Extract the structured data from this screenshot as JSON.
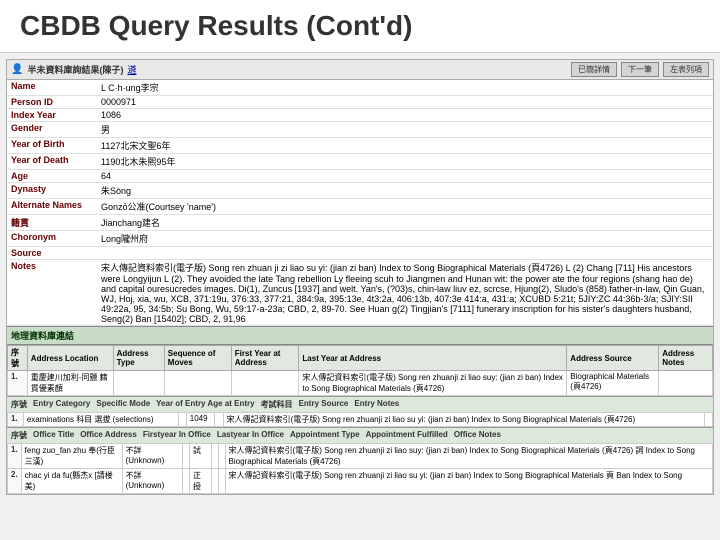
{
  "header": {
    "title": "CBDB Query Results (Cont'd)"
  },
  "topbar": {
    "person_label": "半未資料庫詢結果(陳子)",
    "link_text": "遴",
    "nav_buttons": [
      "已簡詳情",
      "下一筆",
      "左表列項"
    ]
  },
  "person": {
    "fields": [
      {
        "label": "Name",
        "value": "L C·h·ung李宗"
      },
      {
        "label": "Person ID",
        "value": "0000971"
      },
      {
        "label": "Index Year",
        "value": "1086"
      },
      {
        "label": "Gender",
        "value": "男"
      },
      {
        "label": "Year of Birth",
        "value": "1127北宋文聖6年"
      },
      {
        "label": "Year of Death",
        "value": "1190北木朱熙95年"
      },
      {
        "label": "Age",
        "value": "64"
      },
      {
        "label": "Dynasty",
        "value": "朱Sòng"
      },
      {
        "label": "Alternate Names",
        "value": "Gonzō公准(Courtsey 'name')"
      },
      {
        "label": "籍貫",
        "value": "Jianchang建名"
      },
      {
        "label": "Choronym",
        "value": "Long隴州府"
      },
      {
        "label": "Source",
        "value": ""
      },
      {
        "label": "Notes",
        "value": "宋人傳記資料索引(電子版) Song ren zhuan ji zi liao su yi: (jian zi ban) Index to Song Biographical Materials (頁4726)\nL (2) Chang [711] His ancestors were Longyijun L (2). They avoided the late Tang rebellion Ly fleeing scuh to Jiangmen and Hunan wit: the power ate the four regions (shang hao de) and capital ouresucredes images. Di(1), Zuncus [1937] and welt. Yan's, (?03)s, chin-law liuv ez, scrcse, Hjung(2), Sludo's (858) father-in-law, Qin Guan, WJ, Hoj, xia, wu, XCB, 371:19u, 376:33, 377:21, 384:9a, 395:13e, 4t3:2a, 406:13b, 407:3e 414:a, 431:a; XCUBD 5:21t; 5JIY:ZC 44:36b-3/a; SJIY:SII 49:22a, 95, 34:5b; Su Bong, Wu, 59:17-a-23a; CBD, 2, 89-70. See Huan g(2) Tingjian's [7111] funerary inscription for his sister's daughters husband, Seng(2) Ban [15402]; CBD, 2, 91,96"
      }
    ]
  },
  "section1": {
    "title": "地理資料庫連結",
    "columns": [
      "序號",
      "Address Location",
      "Address Type",
      "Sequence of Moves",
      "First Year at Address",
      "Last Year at Address",
      "Address Source",
      "Address Notes"
    ],
    "rows": [
      {
        "seq": "1.",
        "location": "重慶建川加利-同鹽 籍貫優素顏",
        "type": "",
        "sequence": "",
        "first_year": "",
        "last_year": "宋人傳記資料索引(電子版) Song ren zhuanji zi liao suy: (jian zi ban) Index to Song Biographical Materials (頁4726)",
        "source": "Biographical Materials (頁4726)",
        "notes": ""
      }
    ]
  },
  "section2": {
    "title": "",
    "sub_cols1": [
      "序號",
      "Entry Category",
      "Specific Mode",
      "Year of Entry Age at Entry",
      "考試科目",
      "Entry Source",
      "Entry Notes"
    ],
    "sub_rows1": [
      {
        "seq": "1.",
        "category": "examinations 科目 選拔 (selections)",
        "mode": "",
        "year": "1049",
        "age": "",
        "source": "宋人傳記資料索引(電子版) Song ren zhuanji zi liao su yi: (jian zi ban) Index to Song Biographical Materials (頁4726)",
        "notes": ""
      }
    ]
  },
  "section3": {
    "sub_cols": [
      "序號",
      "Office Title",
      "Office Address",
      "Firstyear In Office",
      "Lastyear In Office",
      "Appointment Type",
      "Appointment Fulfilled",
      "Office Notes"
    ],
    "sub_rows": [
      {
        "seq": "1.",
        "title": "feng zuo_fan zhu 奉(行臣三漢)",
        "address": "不詳 (Unknown)",
        "first": "",
        "last": "試",
        "appt_type": "",
        "fulfilled": "",
        "notes": "宋人傳記資料索引(電子版) Song ren zhuanji zi liao suy: (jian zi ban) Index to Song Biographical Materials (頁4726) 詞 Index to Song Biographical Materials (頁4726)"
      },
      {
        "seq": "2.",
        "title": "chac yi da fu(縣杰x [請楼 美)",
        "address": "不詳 (Unknown)",
        "first": "",
        "last": "正授",
        "appt_type": "",
        "fulfilled": "",
        "notes": "宋人傳記資料索引(電子版) Song ren zhuanji zi liao su yi: (jian zi ban) Index to Song Biographical Materials 頁 Ban Index to Song"
      }
    ]
  }
}
